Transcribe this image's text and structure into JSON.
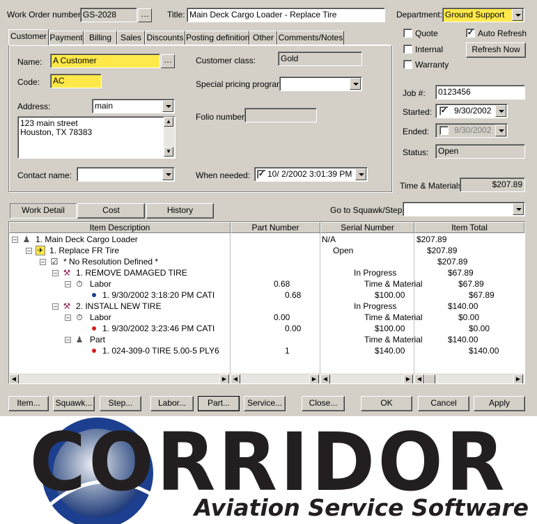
{
  "header": {
    "work_order_label": "Work Order number:",
    "work_order_value": "GS-2028",
    "title_label": "Title:",
    "title_value": "Main Deck Cargo Loader - Replace Tire",
    "department_label": "Department:",
    "department_value": "Ground Support"
  },
  "tabs": [
    "Customer",
    "Payment",
    "Billing",
    "Sales",
    "Discounts",
    "Posting definition",
    "Other",
    "Comments/Notes"
  ],
  "customer": {
    "name_label": "Name:",
    "name_value": "A Customer",
    "code_label": "Code:",
    "code_value": "AC",
    "address_label": "Address:",
    "address_select": "main",
    "address_line1": "123 main street",
    "address_line2": "Houston, TX 78383",
    "contact_label": "Contact name:",
    "contact_value": "",
    "class_label": "Customer class:",
    "class_value": "Gold",
    "pricing_label": "Special pricing program:",
    "pricing_value": "",
    "folio_label": "Folio number:",
    "folio_value": "",
    "needed_label": "When needed:",
    "needed_value": "10/  2/2002   3:01:39 PM"
  },
  "right_panel": {
    "quote_label": "Quote",
    "internal_label": "Internal",
    "warranty_label": "Warranty",
    "auto_refresh_label": "Auto Refresh",
    "refresh_now_label": "Refresh Now",
    "job_label": "Job #:",
    "job_value": "0123456",
    "started_label": "Started:",
    "started_value": "9/30/2002",
    "ended_label": "Ended:",
    "ended_value": "9/30/2002",
    "status_label": "Status:",
    "status_value": "Open",
    "tm_label": "Time & Materials:",
    "tm_value": "$207.89"
  },
  "subtabs": {
    "work_detail": "Work Detail",
    "cost": "Cost",
    "history": "History",
    "goto_label": "Go to Squawk/Step:",
    "goto_value": ""
  },
  "grid": {
    "columns": [
      "Item Description",
      "Part Number",
      "Serial Number",
      "Item Total"
    ],
    "rows": [
      {
        "desc": "1. Main Deck Cargo Loader",
        "part": "",
        "serial": "N/A",
        "total": "$207.89"
      },
      {
        "desc": "1. Replace FR Tire",
        "part": "",
        "serial": "Open",
        "total": "$207.89"
      },
      {
        "desc": "* No Resolution Defined *",
        "part": "",
        "serial": "",
        "total": "$207.89"
      },
      {
        "desc": "1. REMOVE DAMAGED TIRE",
        "part": "",
        "serial": "In Progress",
        "total": "$67.89"
      },
      {
        "desc": "Labor",
        "part": "0.68",
        "serial": "Time & Material",
        "total": "$67.89"
      },
      {
        "desc": "1. 9/30/2002 3:18:20 PM CATI",
        "part": "0.68",
        "serial": "$100.00",
        "total": "$67.89"
      },
      {
        "desc": "2. INSTALL NEW TIRE",
        "part": "",
        "serial": "In Progress",
        "total": "$140.00"
      },
      {
        "desc": "Labor",
        "part": "0.00",
        "serial": "Time & Material",
        "total": "$0.00"
      },
      {
        "desc": "1. 9/30/2002 3:23:46 PM CATI",
        "part": "0.00",
        "serial": "$100.00",
        "total": "$0.00"
      },
      {
        "desc": "Part",
        "part": "",
        "serial": "Time & Material",
        "total": "$140.00"
      },
      {
        "desc": "1. 024-309-0 TIRE 5.00-5 PLY6",
        "part": "1",
        "serial": "$140.00",
        "total": "$140.00"
      }
    ]
  },
  "buttons": {
    "item": "Item...",
    "squawk": "Squawk...",
    "step": "Step...",
    "labor": "Labor...",
    "part": "Part...",
    "service": "Service...",
    "close": "Close...",
    "ok": "OK",
    "cancel": "Cancel",
    "apply": "Apply"
  },
  "logo": {
    "wordmark": "CORRIDOR",
    "tagline": "Aviation Service Software"
  },
  "colors": {
    "window_bg": "#d4d0c8",
    "required_field": "#ffe94a",
    "logo_dark": "#231f20",
    "logo_blue": "#1c3f8f"
  }
}
